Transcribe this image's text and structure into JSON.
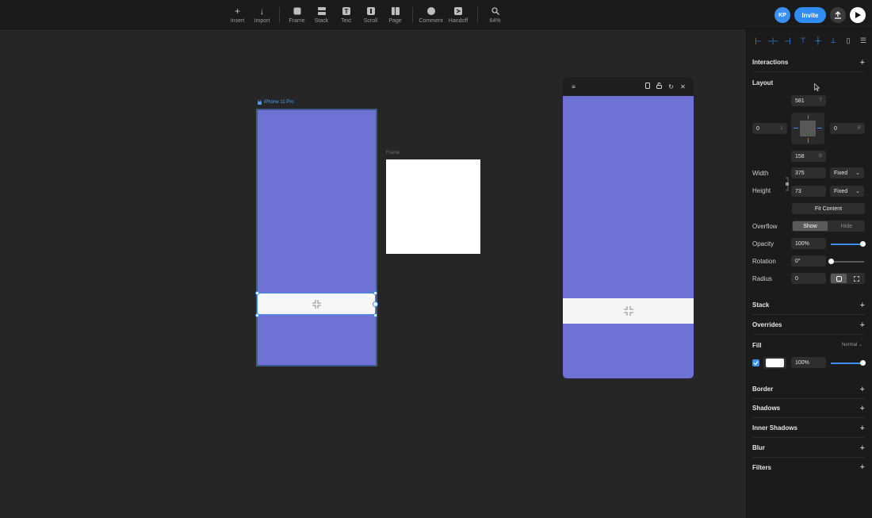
{
  "toolbar": {
    "items": [
      {
        "label": "Insert",
        "icon": "plus-icon"
      },
      {
        "label": "Import",
        "icon": "arrow-down-icon"
      },
      {
        "label": "Frame",
        "icon": "frame-icon"
      },
      {
        "label": "Stack",
        "icon": "stack-icon"
      },
      {
        "label": "Text",
        "icon": "text-icon"
      },
      {
        "label": "Scroll",
        "icon": "scroll-icon"
      },
      {
        "label": "Page",
        "icon": "page-icon"
      },
      {
        "label": "Comment",
        "icon": "comment-icon"
      },
      {
        "label": "Handoff",
        "icon": "handoff-icon"
      },
      {
        "label": "64%",
        "icon": "search-icon"
      }
    ],
    "avatar": "KP",
    "invite": "Invite"
  },
  "canvas": {
    "phone_label": "iPhone 11 Pro",
    "frame_label": "Frame",
    "colors": {
      "phone_fill": "#6e72d4",
      "canvas_bg": "#262626",
      "selection": "#3b8ff0"
    }
  },
  "panel": {
    "interactions": "Interactions",
    "layout": "Layout",
    "top": "581",
    "top_suffix": "T",
    "left": "0",
    "left_suffix": "L",
    "right": "0",
    "right_suffix": "R",
    "bottom": "158",
    "bottom_suffix": "B",
    "width_label": "Width",
    "width_value": "375",
    "width_mode": "Fixed",
    "height_label": "Height",
    "height_value": "73",
    "height_mode": "Fixed",
    "fit_content": "Fit Content",
    "overflow_label": "Overflow",
    "overflow_show": "Show",
    "overflow_hide": "Hide",
    "opacity_label": "Opacity",
    "opacity_value": "100%",
    "opacity_level": 1.0,
    "rotation_label": "Rotation",
    "rotation_value": "0°",
    "rotation_level": 0.0,
    "radius_label": "Radius",
    "radius_value": "0",
    "stack": "Stack",
    "overrides": "Overrides",
    "fill": "Fill",
    "fill_blend": "Normal",
    "fill_opacity": "100%",
    "fill_color": "#ffffff",
    "fill_level": 1.0,
    "border": "Border",
    "shadows": "Shadows",
    "inner_shadows": "Inner Shadows",
    "blur": "Blur",
    "filters": "Filters"
  }
}
